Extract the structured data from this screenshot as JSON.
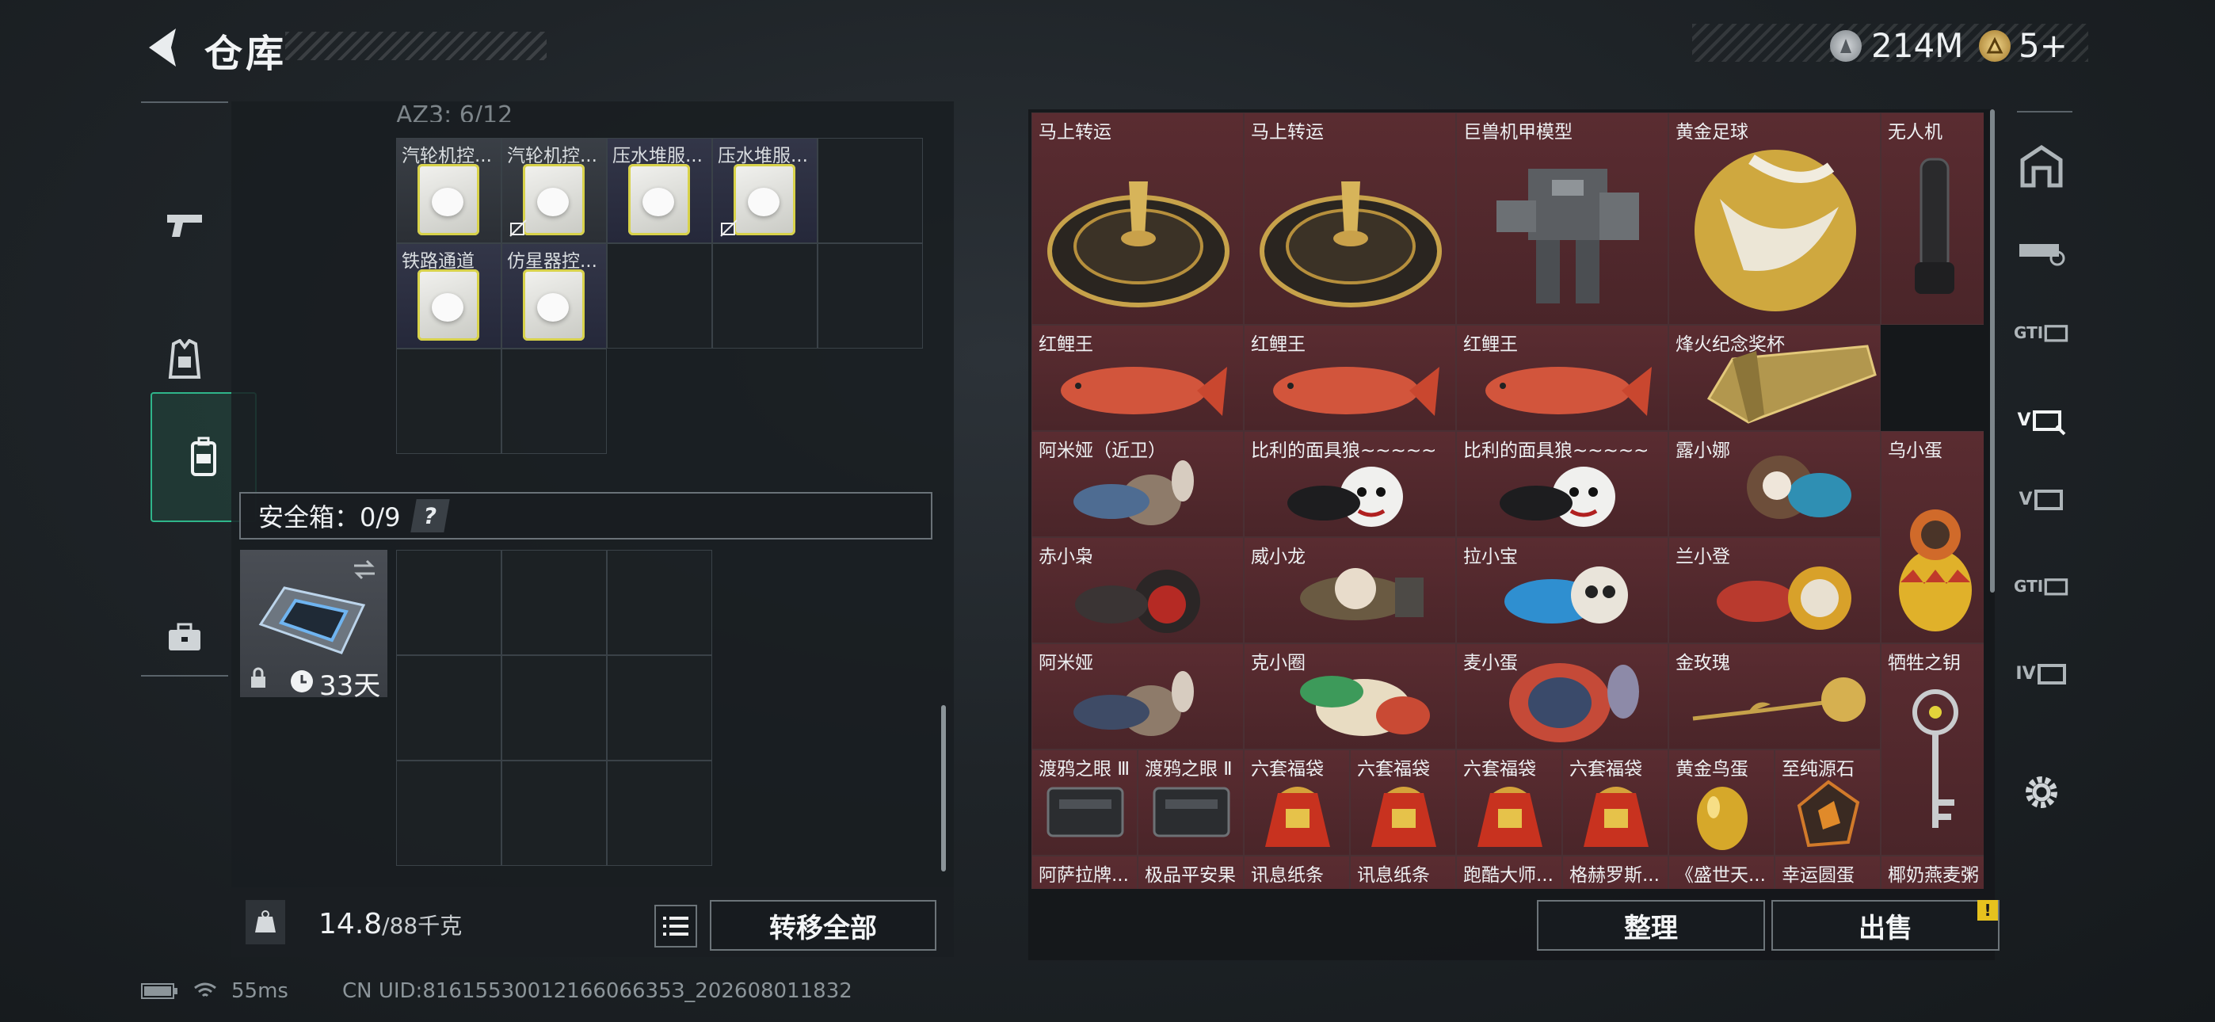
{
  "header": {
    "title": "仓库",
    "currencies": [
      {
        "icon": "silver-coin-icon",
        "value": "214M"
      },
      {
        "icon": "gold-triangle-coin-icon",
        "value": "5+"
      }
    ]
  },
  "sidebar": {
    "items": [
      {
        "icon": "pistol-icon",
        "active": false
      },
      {
        "icon": "vest-icon",
        "active": false
      },
      {
        "icon": "backpack-icon",
        "active": true
      },
      {
        "icon": "briefcase-icon",
        "active": false
      }
    ]
  },
  "backpack": {
    "section_label": "AZ3: 6/12",
    "items": [
      {
        "name": "汽轮机控...",
        "locked": false
      },
      {
        "name": "汽轮机控...",
        "locked": true
      },
      {
        "name": "压水堆服...",
        "locked": false
      },
      {
        "name": "压水堆服...",
        "locked": true
      },
      {
        "name": "铁路通道",
        "locked": false
      },
      {
        "name": "仿星器控...",
        "locked": false
      }
    ]
  },
  "safe_box": {
    "label": "安全箱：0/9",
    "help": "?",
    "duration": "33天"
  },
  "weight": {
    "current": "14.8",
    "max": "/88千克"
  },
  "buttons": {
    "transfer_all": "转移全部",
    "organize": "整理",
    "sell": "出售",
    "sell_alert": "!"
  },
  "stash": {
    "items": [
      {
        "name": "马上转运",
        "icon": "horse-wheel-icon"
      },
      {
        "name": "马上转运",
        "icon": "horse-wheel-icon"
      },
      {
        "name": "巨兽机甲模型",
        "icon": "mech-model-icon"
      },
      {
        "name": "黄金足球",
        "icon": "golden-ball-icon"
      },
      {
        "name": "无人机",
        "icon": "drone-icon"
      },
      {
        "name": "红鲤王",
        "icon": "red-carp-icon"
      },
      {
        "name": "红鲤王",
        "icon": "red-carp-icon"
      },
      {
        "name": "红鲤王",
        "icon": "red-carp-icon"
      },
      {
        "name": "烽火纪念奖杯",
        "icon": "trophy-icon"
      },
      {
        "name": "阿米娅（近卫）",
        "icon": "figure-icon"
      },
      {
        "name": "比利的面具狼~~~~~",
        "icon": "masked-figure-icon"
      },
      {
        "name": "比利的面具狼~~~~~",
        "icon": "masked-figure-icon"
      },
      {
        "name": "露小娜",
        "icon": "figure-icon"
      },
      {
        "name": "乌小蛋",
        "icon": "egg-figure-icon"
      },
      {
        "name": "赤小枭",
        "icon": "figure-icon"
      },
      {
        "name": "威小龙",
        "icon": "figure-icon"
      },
      {
        "name": "拉小宝",
        "icon": "figure-icon"
      },
      {
        "name": "兰小登",
        "icon": "figure-icon"
      },
      {
        "name": "阿米娅",
        "icon": "figure-icon"
      },
      {
        "name": "克小圈",
        "icon": "figure-icon"
      },
      {
        "name": "麦小蛋",
        "icon": "egg-figure-icon"
      },
      {
        "name": "金玫瑰",
        "icon": "golden-rose-icon"
      },
      {
        "name": "牺牲之钥",
        "icon": "key-icon"
      },
      {
        "name": "渡鸦之眼 Ⅲ",
        "icon": "device-icon"
      },
      {
        "name": "渡鸦之眼 Ⅱ",
        "icon": "device-icon"
      },
      {
        "name": "六套福袋",
        "icon": "lucky-bag-icon"
      },
      {
        "name": "六套福袋",
        "icon": "lucky-bag-icon"
      },
      {
        "name": "六套福袋",
        "icon": "lucky-bag-icon"
      },
      {
        "name": "六套福袋",
        "icon": "lucky-bag-icon"
      },
      {
        "name": "黄金鸟蛋",
        "icon": "golden-egg-icon"
      },
      {
        "name": "至纯源石",
        "icon": "gem-icon"
      },
      {
        "name": "阿萨拉牌...",
        "icon": "item-icon"
      },
      {
        "name": "极品平安果",
        "icon": "item-icon"
      },
      {
        "name": "讯息纸条",
        "icon": "item-icon"
      },
      {
        "name": "讯息纸条",
        "icon": "item-icon"
      },
      {
        "name": "跑酷大师...",
        "icon": "item-icon"
      },
      {
        "name": "格赫罗斯...",
        "icon": "item-icon"
      },
      {
        "name": "《盛世天...",
        "icon": "item-icon"
      },
      {
        "name": "幸运圆蛋",
        "icon": "item-icon"
      },
      {
        "name": "椰奶燕麦粥",
        "icon": "item-icon"
      }
    ]
  },
  "right_tabs": [
    {
      "icon": "building-icon",
      "label": ""
    },
    {
      "icon": "gun-case-icon",
      "label": ""
    },
    {
      "icon": "gti-case-icon",
      "label": "GTI"
    },
    {
      "icon": "v-case-icon",
      "label": "V",
      "active": true
    },
    {
      "icon": "v-case-icon",
      "label": "V"
    },
    {
      "icon": "gti-case-icon",
      "label": "GTI"
    },
    {
      "icon": "iv-case-icon",
      "label": "IV"
    }
  ],
  "status": {
    "ping": "55ms",
    "uid": "CN UID:8161553001216606635З_202608011832"
  }
}
